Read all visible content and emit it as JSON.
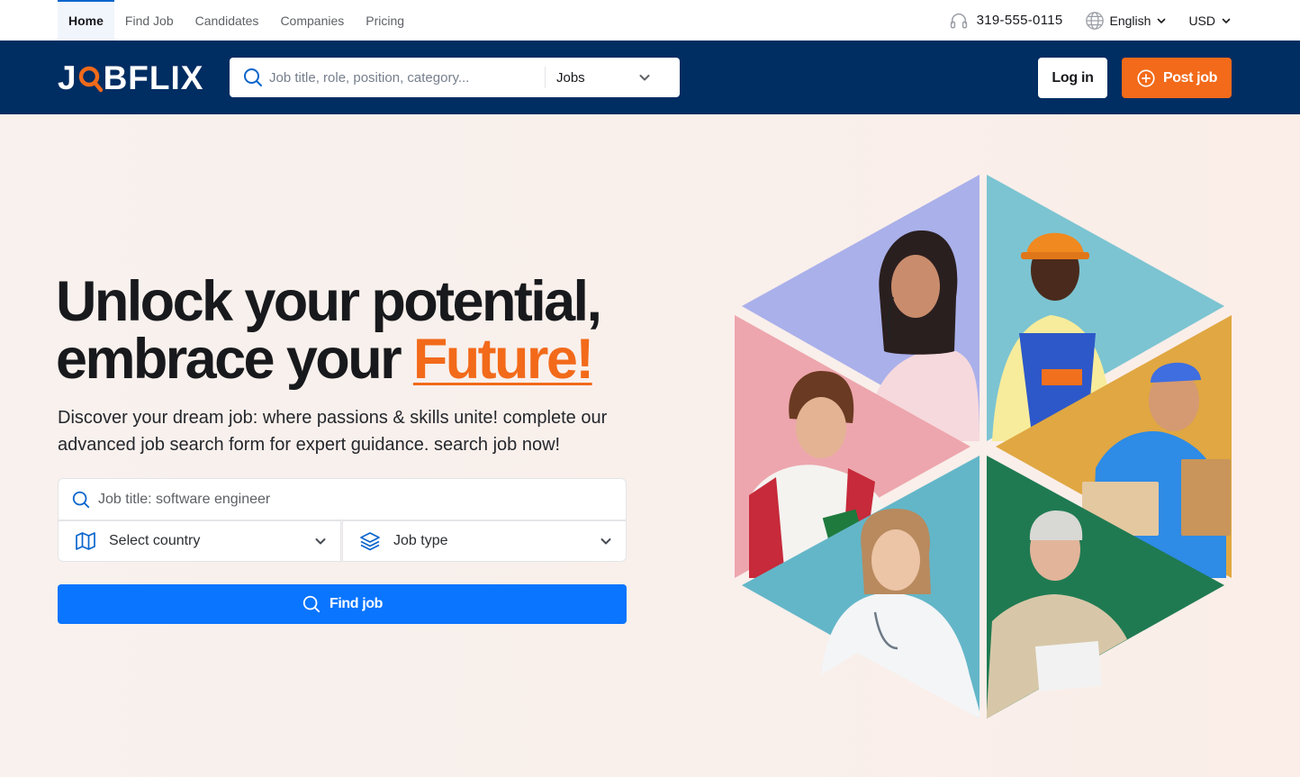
{
  "topnav": {
    "items": [
      {
        "label": "Home",
        "active": true
      },
      {
        "label": "Find Job",
        "active": false
      },
      {
        "label": "Candidates",
        "active": false
      },
      {
        "label": "Companies",
        "active": false
      },
      {
        "label": "Pricing",
        "active": false
      }
    ],
    "phone": "319-555-0115",
    "language": "English",
    "currency": "USD"
  },
  "header": {
    "logo_parts": [
      "J",
      "BFLIX"
    ],
    "search_placeholder": "Job title, role, position, category...",
    "search_category": "Jobs",
    "login_label": "Log in",
    "post_job_label": "Post job"
  },
  "hero": {
    "headline_line1": "Unlock your potential,",
    "headline_line2": "embrace your ",
    "headline_accent": "Future!",
    "subtitle": "Discover your dream job: where passions & skills unite! complete our advanced job search form for expert guidance. search job now!",
    "job_placeholder": "Job title: software engineer",
    "country_label": "Select country",
    "job_type_label": "Job type",
    "find_button": "Find job"
  },
  "colors": {
    "navy": "#002d62",
    "orange": "#f26a1a",
    "blue": "#0a75ff",
    "tile_purple": "#aab0ea",
    "tile_teal": "#7cc4d2",
    "tile_pink": "#eda6ad",
    "tile_gold": "#e0a742",
    "tile_cyan": "#63b6c8",
    "tile_green": "#1f7a52"
  },
  "icons": [
    "search-icon",
    "headset-icon",
    "globe-icon",
    "chevron-down-icon",
    "map-icon",
    "layers-icon",
    "plus-circle-icon"
  ],
  "collage": {
    "photos": [
      "person-headset",
      "construction-worker",
      "student",
      "delivery-man",
      "doctor",
      "senior-teacher"
    ]
  }
}
